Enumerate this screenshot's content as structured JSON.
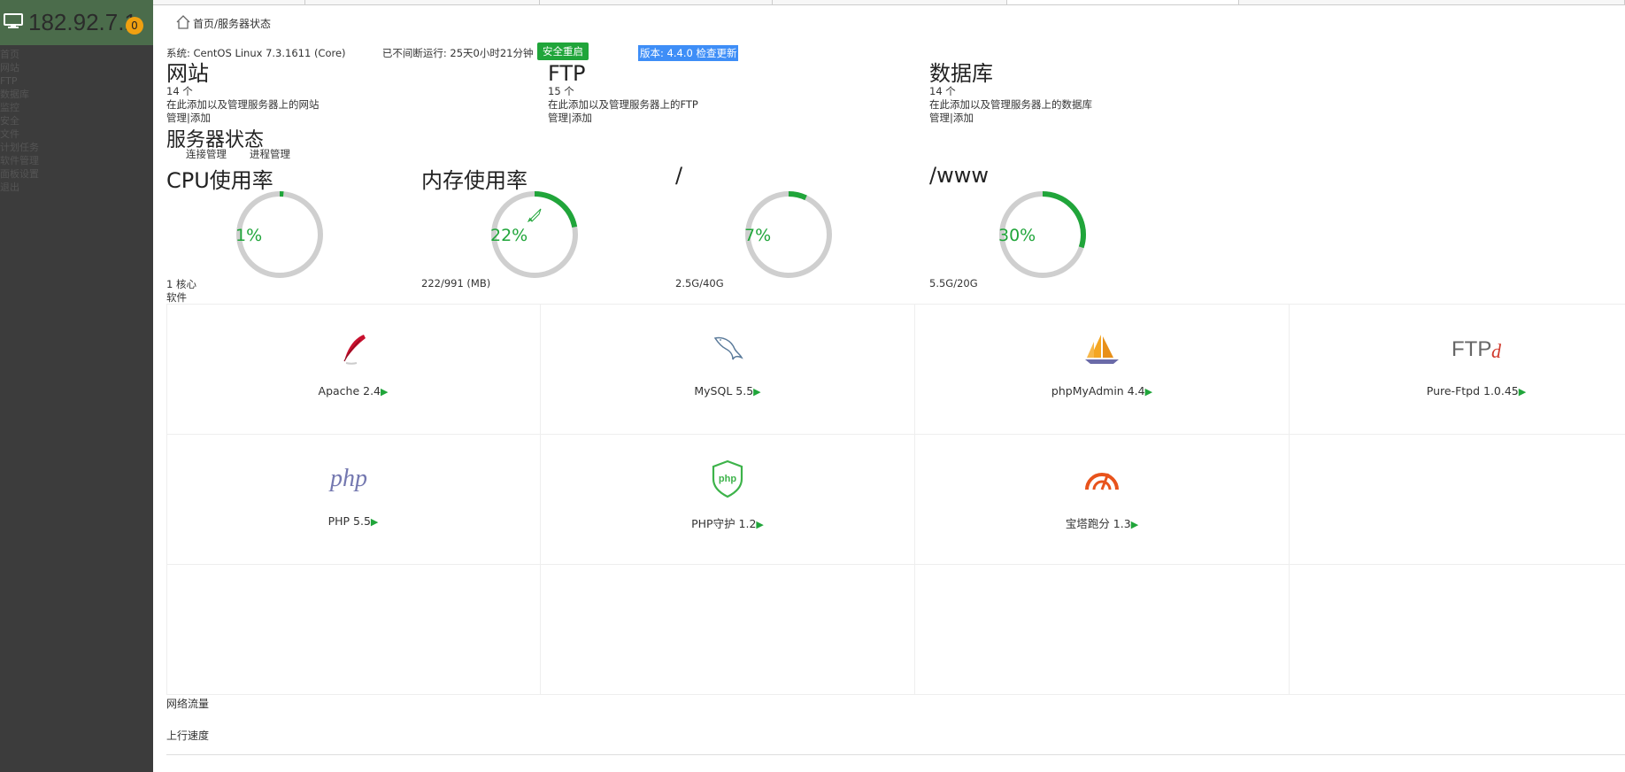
{
  "sidebar": {
    "ip": "182.92.7.1",
    "badge": "0",
    "menu": [
      "首页",
      "网站",
      "FTP",
      "数据库",
      "监控",
      "安全",
      "文件",
      "计划任务",
      "软件管理",
      "面板设置",
      "退出"
    ]
  },
  "header": {
    "breadcrumb": "首页/服务器状态"
  },
  "system": {
    "os": "系统: CentOS Linux 7.3.1611 (Core)",
    "uptime": "已不间断运行: 25天0小时21分钟",
    "restart_label": "安全重启",
    "version_label": "版本: 4.4.0 检查更新"
  },
  "overview": [
    {
      "title": "网站",
      "count": "14 个",
      "desc": "在此添加以及管理服务器上的网站",
      "links": "管理|添加"
    },
    {
      "title": "FTP",
      "count": "15 个",
      "desc": "在此添加以及管理服务器上的FTP",
      "links": "管理|添加"
    },
    {
      "title": "数据库",
      "count": "14 个",
      "desc": "在此添加以及管理服务器上的数据库",
      "links": "管理|添加"
    }
  ],
  "server_status": {
    "title": "服务器状态",
    "link_connections": "连接管理",
    "link_processes": "进程管理"
  },
  "gauges": [
    {
      "title": "CPU使用率",
      "percent": 1,
      "label": "1%",
      "sub": "1 核心"
    },
    {
      "title": "内存使用率",
      "percent": 22,
      "label": "22%",
      "sub": "222/991 (MB)",
      "icon": "rocket-icon"
    },
    {
      "title": "/",
      "percent": 7,
      "label": "7%",
      "sub": "2.5G/40G"
    },
    {
      "title": "/www",
      "percent": 30,
      "label": "30%",
      "sub": "5.5G/20G"
    }
  ],
  "software": {
    "label": "软件",
    "items": [
      {
        "name": "Apache 2.4",
        "icon": "apache-feather-icon"
      },
      {
        "name": "MySQL 5.5",
        "icon": "mysql-dolphin-icon"
      },
      {
        "name": "phpMyAdmin 4.4",
        "icon": "phpmyadmin-sailboat-icon"
      },
      {
        "name": "Pure-Ftpd 1.0.45",
        "icon": "ftpd-logo-icon"
      },
      {
        "name": "PHP 5.5",
        "icon": "php-logo-icon"
      },
      {
        "name": "PHP守护 1.2",
        "icon": "php-shield-icon"
      },
      {
        "name": "宝塔跑分 1.3",
        "icon": "speedometer-icon"
      }
    ]
  },
  "network": {
    "title": "网络流量",
    "upload_label": "上行速度"
  },
  "colors": {
    "accent": "#20a53a",
    "sidebar_bg": "#3c3c3c",
    "sidebar_head": "#4b6c4b",
    "version_bg": "#3e8ef7",
    "badge": "#f0a010"
  }
}
